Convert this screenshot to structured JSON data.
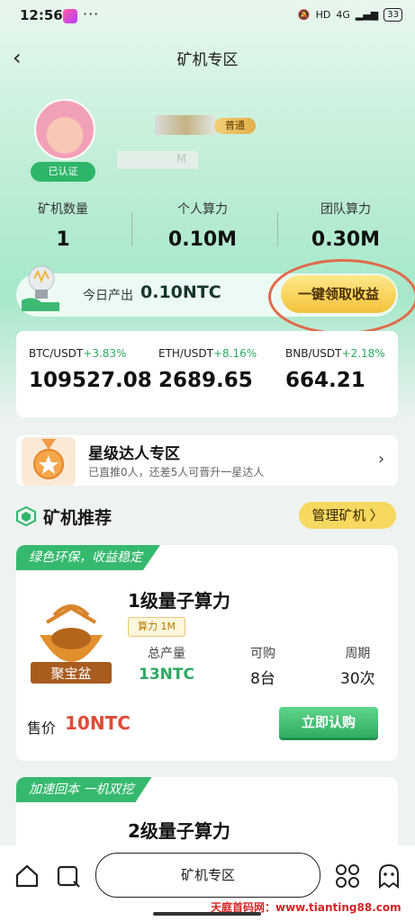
{
  "status_bar": {
    "time": "12:56",
    "dots": "···",
    "network": "4G",
    "hd": "HD",
    "battery": "33"
  },
  "header": {
    "title": "矿机专区",
    "back_icon": "chevron-left-icon"
  },
  "profile": {
    "level_badge": "普通",
    "verified_label": "已认证",
    "name_tail": "M"
  },
  "stats": [
    {
      "label": "矿机数量",
      "value": "1"
    },
    {
      "label": "个人算力",
      "value": "0.10M"
    },
    {
      "label": "团队算力",
      "value": "0.30M"
    }
  ],
  "earnings": {
    "label": "今日产出",
    "value": "0.10NTC",
    "claim_button": "一键领取收益"
  },
  "prices": [
    {
      "pair": "BTC/USDT",
      "change": "+3.83%",
      "price": "109527.08"
    },
    {
      "pair": "ETH/USDT",
      "change": "+8.16%",
      "price": "2689.65"
    },
    {
      "pair": "BNB/USDT",
      "change": "+2.18%",
      "price": "664.21"
    }
  ],
  "star_section": {
    "title": "星级达人专区",
    "subtitle": "已直推0人，还差5人可晋升一星达人"
  },
  "recommend": {
    "title": "矿机推荐",
    "manage_button": "管理矿机 〉"
  },
  "products": [
    {
      "tag": "绿色环保，收益稳定",
      "logo_text": "聚宝盆",
      "title": "1级量子算力",
      "power_badge": "算力 1M",
      "metrics": [
        {
          "label": "总产量",
          "value": "13NTC"
        },
        {
          "label": "可购",
          "value": "8台"
        },
        {
          "label": "周期",
          "value": "30次"
        }
      ],
      "price_label": "售价",
      "price_value": "10NTC",
      "buy_button": "立即认购"
    },
    {
      "tag": "加速回本 一机双挖",
      "title": "2级量子算力"
    }
  ],
  "browser": {
    "url_text": "矿机专区"
  },
  "watermark": "天庭首码网：www.tianting88.com",
  "colors": {
    "accent_green": "#35b96f",
    "gold": "#f2c23b",
    "price_red": "#e04a36"
  }
}
